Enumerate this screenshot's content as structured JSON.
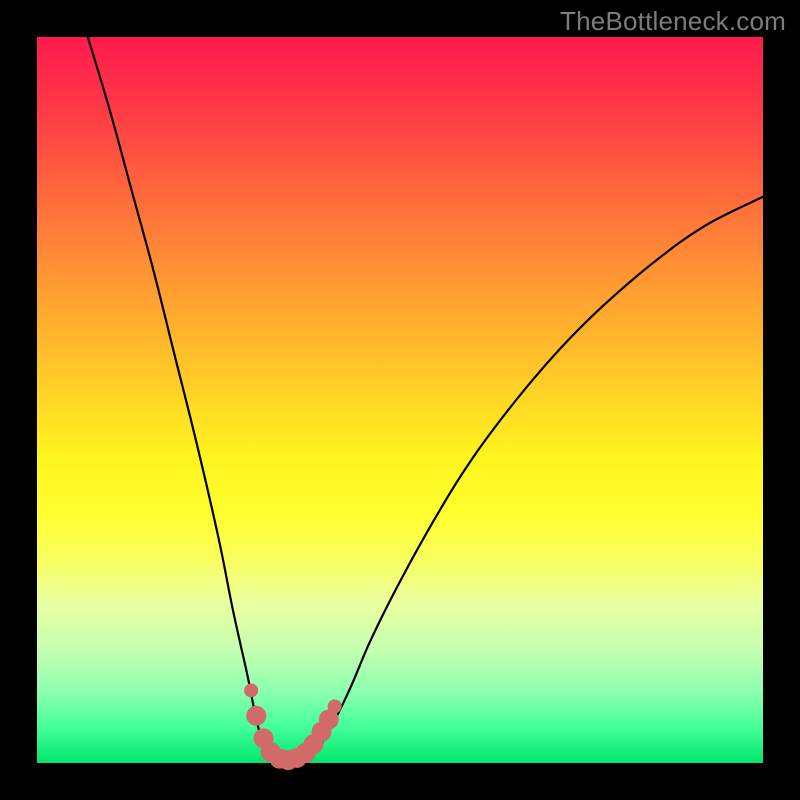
{
  "watermark": "TheBottleneck.com",
  "chart_data": {
    "type": "line",
    "title": "",
    "xlabel": "",
    "ylabel": "",
    "xlim": [
      0,
      100
    ],
    "ylim": [
      0,
      100
    ],
    "series": [
      {
        "name": "bottleneck-curve",
        "color": "#000000",
        "x": [
          7,
          10,
          13,
          16,
          19,
          22,
          25,
          27,
          29,
          30,
          31,
          32,
          33.5,
          35,
          36.5,
          38,
          40,
          43,
          46,
          50,
          55,
          60,
          66,
          72,
          78,
          85,
          92,
          100
        ],
        "y": [
          100,
          90,
          79,
          68,
          56,
          44,
          31,
          21,
          12,
          7,
          3,
          1,
          0,
          0,
          0,
          1,
          4,
          10,
          17,
          25,
          34,
          42,
          50,
          57,
          63,
          69,
          74,
          78
        ]
      }
    ],
    "markers": {
      "name": "highlight-points",
      "color": "#d36a6a",
      "radius_small": 7,
      "radius_large": 10,
      "points": [
        {
          "x": 29.5,
          "y": 10,
          "r": "small"
        },
        {
          "x": 30.2,
          "y": 6.5,
          "r": "large"
        },
        {
          "x": 31.2,
          "y": 3.4,
          "r": "large"
        },
        {
          "x": 32.2,
          "y": 1.5,
          "r": "large"
        },
        {
          "x": 33.4,
          "y": 0.6,
          "r": "large"
        },
        {
          "x": 34.6,
          "y": 0.4,
          "r": "large"
        },
        {
          "x": 35.8,
          "y": 0.7,
          "r": "large"
        },
        {
          "x": 37.0,
          "y": 1.4,
          "r": "large"
        },
        {
          "x": 38.1,
          "y": 2.6,
          "r": "large"
        },
        {
          "x": 39.2,
          "y": 4.3,
          "r": "large"
        },
        {
          "x": 40.2,
          "y": 6.0,
          "r": "large"
        },
        {
          "x": 41.0,
          "y": 7.8,
          "r": "small"
        }
      ]
    },
    "background_gradient": {
      "top": "#ff1a4d",
      "middle": "#fff51e",
      "bottom": "#00e66c"
    }
  }
}
